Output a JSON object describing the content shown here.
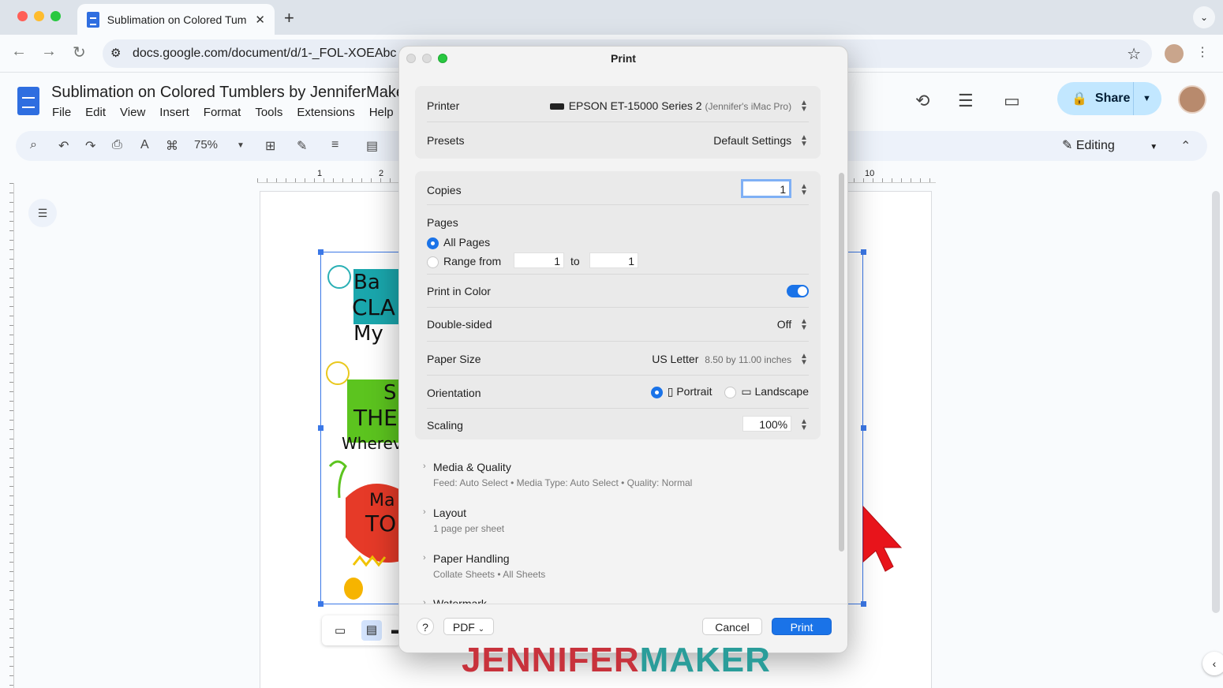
{
  "browser": {
    "tab_title": "Sublimation on Colored Tumb",
    "url": "docs.google.com/document/d/1-_FOL-XOEAbc"
  },
  "docs": {
    "title": "Sublimation on Colored Tumblers by JenniferMaker",
    "menu": [
      "File",
      "Edit",
      "View",
      "Insert",
      "Format",
      "Tools",
      "Extensions",
      "Help"
    ],
    "share_label": "Share",
    "zoom": "75%",
    "mode": "Editing",
    "ruler_labels": [
      "1",
      "2",
      "10"
    ]
  },
  "print_dialog": {
    "title": "Print",
    "printer_label": "Printer",
    "printer_name": "EPSON ET-15000 Series 2",
    "printer_host": "(Jennifer's iMac Pro)",
    "presets_label": "Presets",
    "presets_value": "Default Settings",
    "copies_label": "Copies",
    "copies_value": "1",
    "pages_label": "Pages",
    "all_pages_label": "All Pages",
    "range_label": "Range from",
    "range_from": "1",
    "range_to_label": "to",
    "range_to": "1",
    "color_label": "Print in Color",
    "duplex_label": "Double-sided",
    "duplex_value": "Off",
    "paper_label": "Paper Size",
    "paper_value": "US Letter",
    "paper_dims": "8.50 by 11.00 inches",
    "orientation_label": "Orientation",
    "portrait_label": "Portrait",
    "landscape_label": "Landscape",
    "scaling_label": "Scaling",
    "scaling_value": "100%",
    "sections": [
      {
        "name": "Media & Quality",
        "sub": "Feed: Auto Select • Media Type: Auto Select • Quality: Normal"
      },
      {
        "name": "Layout",
        "sub": "1 page per sheet"
      },
      {
        "name": "Paper Handling",
        "sub": "Collate Sheets • All Sheets"
      },
      {
        "name": "Watermark",
        "sub": ""
      }
    ],
    "help_label": "?",
    "pdf_label": "PDF",
    "cancel_label": "Cancel",
    "print_label": "Print"
  },
  "watermark": {
    "part1": "JENNIFER",
    "part2": "MAKER"
  },
  "colors": {
    "accent": "#1a73e8",
    "share_bg": "#c2e7ff"
  }
}
